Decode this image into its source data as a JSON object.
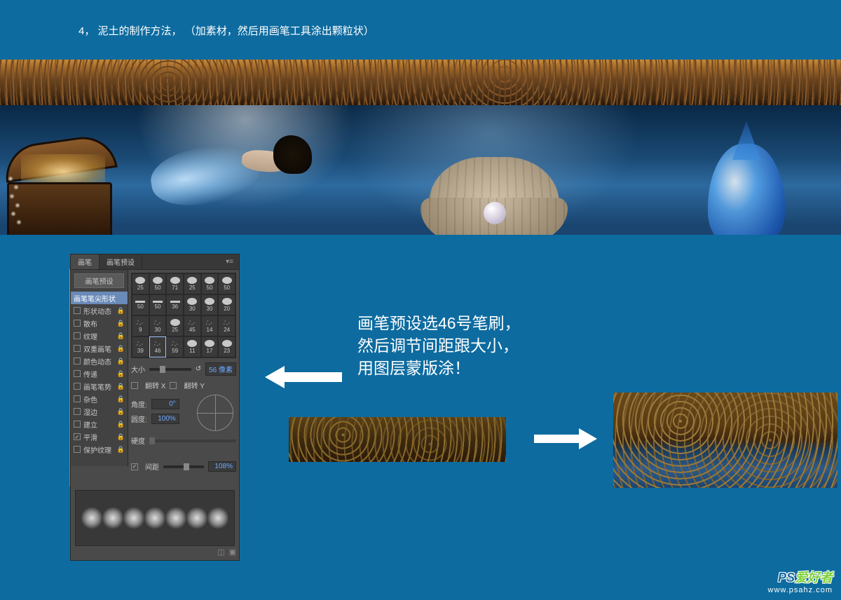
{
  "step": {
    "number": "4，",
    "title": "泥土的制作方法，",
    "note": "（加素材，然后用画笔工具涂出颗粒状）"
  },
  "instruction": {
    "line1": "画笔预设选46号笔刷，",
    "line2": "然后调节间距跟大小，",
    "line3": "用图层蒙版涂！"
  },
  "brush_panel": {
    "tabs": {
      "brush": "画笔",
      "presets": "画笔预设"
    },
    "preset_button": "画笔预设",
    "options": [
      {
        "key": "tip_shape",
        "label": "画笔笔尖形状",
        "checked": false,
        "locked": false,
        "active": true
      },
      {
        "key": "shape_dynamics",
        "label": "形状动态",
        "checked": false,
        "locked": true
      },
      {
        "key": "scattering",
        "label": "散布",
        "checked": false,
        "locked": true
      },
      {
        "key": "texture",
        "label": "纹理",
        "checked": false,
        "locked": true
      },
      {
        "key": "dual_brush",
        "label": "双重画笔",
        "checked": false,
        "locked": true
      },
      {
        "key": "color_dynamics",
        "label": "颜色动态",
        "checked": false,
        "locked": true
      },
      {
        "key": "transfer",
        "label": "传递",
        "checked": false,
        "locked": true
      },
      {
        "key": "brush_pose",
        "label": "画笔笔势",
        "checked": false,
        "locked": true
      },
      {
        "key": "noise",
        "label": "杂色",
        "checked": false,
        "locked": true
      },
      {
        "key": "wet_edges",
        "label": "湿边",
        "checked": false,
        "locked": true
      },
      {
        "key": "buildup",
        "label": "建立",
        "checked": false,
        "locked": true
      },
      {
        "key": "smoothing",
        "label": "平滑",
        "checked": true,
        "locked": true
      },
      {
        "key": "protect_texture",
        "label": "保护纹理",
        "checked": false,
        "locked": true
      }
    ],
    "brush_grid": [
      [
        25,
        50,
        71,
        25,
        50,
        50
      ],
      [
        50,
        50,
        36,
        30,
        30,
        20
      ],
      [
        9,
        30,
        25,
        45,
        14,
        24
      ],
      [
        39,
        46,
        59,
        11,
        17,
        23
      ]
    ],
    "selected_brush": 46,
    "size": {
      "label": "大小",
      "value": "56 像素"
    },
    "flip_x": {
      "label": "翻转 X",
      "checked": false
    },
    "flip_y": {
      "label": "翻转 Y",
      "checked": false
    },
    "angle": {
      "label": "角度:",
      "value": "0°"
    },
    "roundness": {
      "label": "圆度:",
      "value": "100%"
    },
    "hardness": {
      "label": "硬度"
    },
    "spacing": {
      "label": "间距",
      "checked": true,
      "value": "108%"
    }
  },
  "watermark": {
    "prefix": "PS",
    "text": "爱好者",
    "url": "www.psahz.com"
  }
}
